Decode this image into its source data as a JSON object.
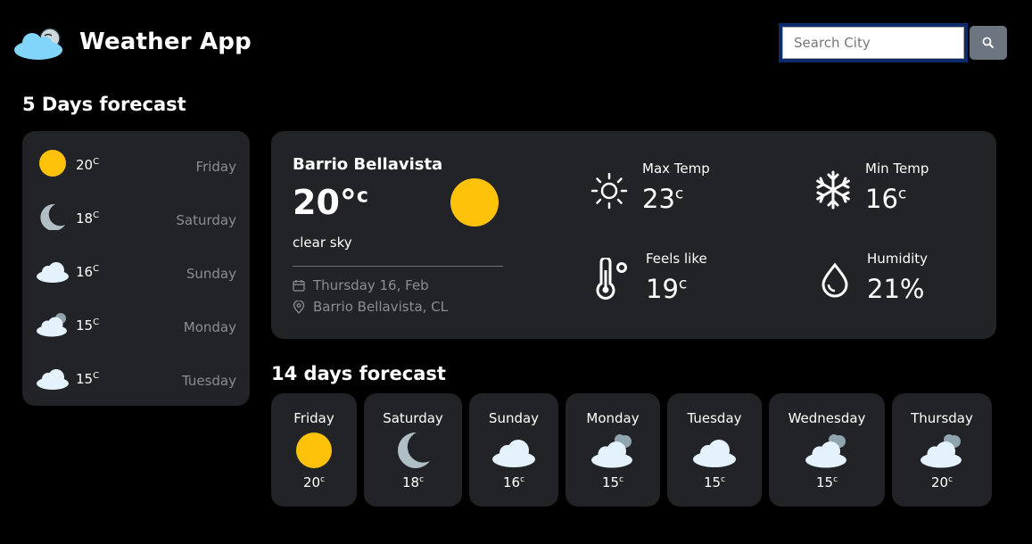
{
  "header": {
    "title": "Weather App",
    "search_placeholder": "Search City"
  },
  "five_day": {
    "title": "5 Days forecast",
    "items": [
      {
        "temp": "20",
        "unit": "C",
        "day": "Friday",
        "icon": "sun-icon"
      },
      {
        "temp": "18",
        "unit": "C",
        "day": "Saturday",
        "icon": "moon-icon"
      },
      {
        "temp": "16",
        "unit": "C",
        "day": "Sunday",
        "icon": "cloud-icon"
      },
      {
        "temp": "15",
        "unit": "C",
        "day": "Monday",
        "icon": "cloudy-icon"
      },
      {
        "temp": "15",
        "unit": "C",
        "day": "Tuesday",
        "icon": "cloud-icon"
      }
    ]
  },
  "current": {
    "city": "Barrio Bellavista",
    "temp": "20°",
    "unit": "c",
    "description": "clear sky",
    "date": "Thursday 16, Feb",
    "location": "Barrio Bellavista, CL",
    "stats": {
      "max_temp": {
        "label": "Max Temp",
        "value": "23",
        "unit": "c"
      },
      "min_temp": {
        "label": "Min Temp",
        "value": "16",
        "unit": "c"
      },
      "feels_like": {
        "label": "Feels like",
        "value": "19",
        "unit": "c"
      },
      "humidity": {
        "label": "Humidity",
        "value": "21%"
      }
    }
  },
  "fourteen_day": {
    "title": "14 days forecast",
    "items": [
      {
        "day": "Friday",
        "temp": "20",
        "unit": "c",
        "icon": "sun-icon"
      },
      {
        "day": "Saturday",
        "temp": "18",
        "unit": "c",
        "icon": "moon-icon"
      },
      {
        "day": "Sunday",
        "temp": "16",
        "unit": "c",
        "icon": "cloud-icon"
      },
      {
        "day": "Monday",
        "temp": "15",
        "unit": "c",
        "icon": "cloudy-icon"
      },
      {
        "day": "Tuesday",
        "temp": "15",
        "unit": "c",
        "icon": "cloud-icon"
      },
      {
        "day": "Wednesday",
        "temp": "15",
        "unit": "c",
        "icon": "cloudy-icon"
      },
      {
        "day": "Thursday",
        "temp": "20",
        "unit": "c",
        "icon": "cloudy-icon"
      }
    ]
  },
  "colors": {
    "background": "#000000",
    "card": "#222326",
    "sun": "#fec20b",
    "moon": "#b0bec5",
    "cloud": "#e3f2fd",
    "muted_text": "#8a8d92"
  }
}
